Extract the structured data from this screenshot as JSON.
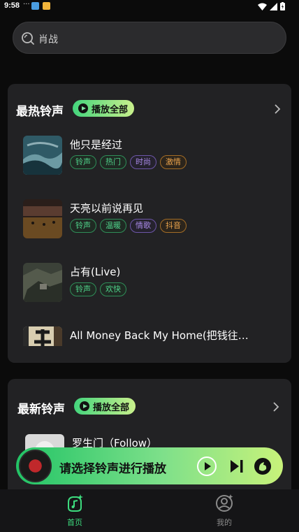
{
  "status_bar": {
    "time": "9:58",
    "dots": "···"
  },
  "search": {
    "placeholder": "肖战"
  },
  "hot_section": {
    "title": "最热铃声",
    "play_all_label": "播放全部",
    "songs": [
      {
        "title": "他只是经过",
        "tags": [
          "铃声",
          "热门",
          "时尚",
          "激情"
        ]
      },
      {
        "title": "天亮以前说再见",
        "tags": [
          "铃声",
          "温暖",
          "情歌",
          "抖音"
        ]
      },
      {
        "title": "占有(Live)",
        "tags": [
          "铃声",
          "欢快"
        ]
      },
      {
        "title": "All Money Back My Home(把钱往…"
      }
    ]
  },
  "new_section": {
    "title": "最新铃声",
    "play_all_label": "播放全部",
    "songs": [
      {
        "title": "罗生门（Follow）"
      }
    ]
  },
  "player": {
    "prompt": "请选择铃声进行播放"
  },
  "bottom_nav": {
    "home_label": "首页",
    "mine_label": "我的"
  },
  "colors": {
    "accent_green": "#3ddb7e",
    "tag_green": "#4fd28a",
    "tag_purple": "#a98ae8",
    "tag_orange": "#e8a24c"
  }
}
